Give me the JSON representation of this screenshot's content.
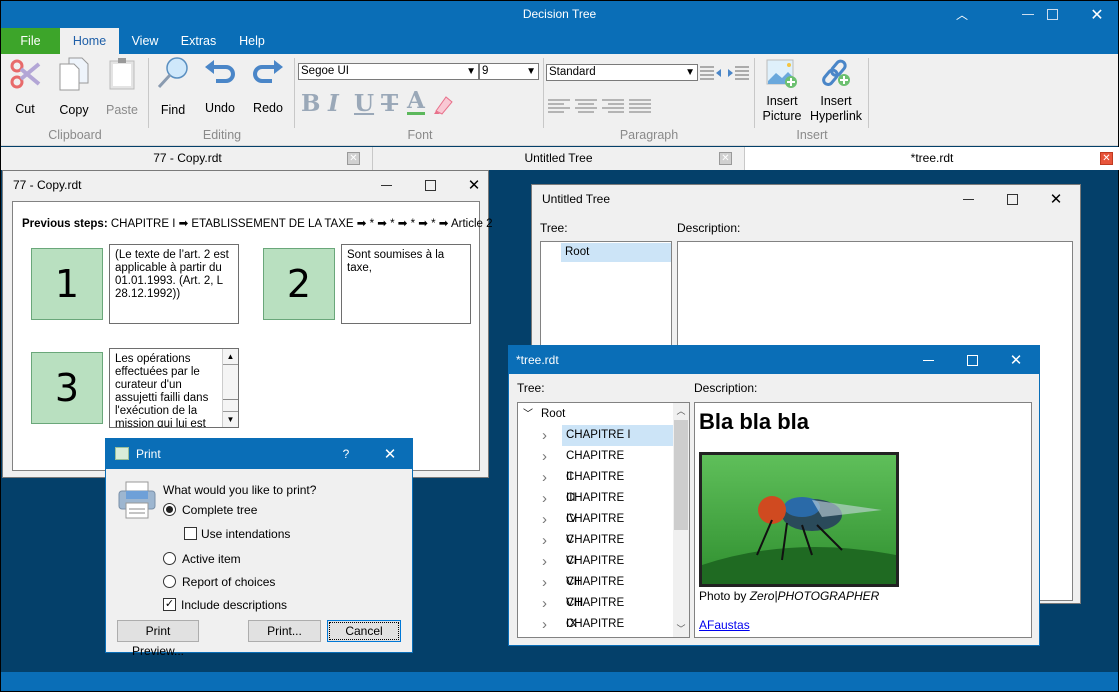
{
  "app": {
    "title": "Decision Tree"
  },
  "menu": {
    "tabs": [
      "File",
      "Home",
      "View",
      "Extras",
      "Help"
    ]
  },
  "ribbon": {
    "clipboard": {
      "label": "Clipboard",
      "cut": "Cut",
      "copy": "Copy",
      "paste": "Paste"
    },
    "editing": {
      "label": "Editing",
      "find": "Find",
      "undo": "Undo",
      "redo": "Redo"
    },
    "font": {
      "label": "Font",
      "family": "Segoe UI",
      "size": "9",
      "styles": [
        "B",
        "I",
        "U",
        "T",
        "A"
      ]
    },
    "paragraph": {
      "label": "Paragraph",
      "style": "Standard"
    },
    "insert": {
      "label": "Insert",
      "picture_l1": "Insert",
      "picture_l2": "Picture",
      "link_l1": "Insert",
      "link_l2": "Hyperlink"
    }
  },
  "doc_tabs": [
    {
      "label": "77 - Copy.rdt",
      "active": false
    },
    {
      "label": "Untitled Tree",
      "active": false
    },
    {
      "label": "*tree.rdt",
      "active": true
    }
  ],
  "win_copy": {
    "title": "77 - Copy.rdt",
    "prev_label": "Previous steps:",
    "prev_path": "CHAPITRE I ➡ ETABLISSEMENT DE LA TAXE ➡ * ➡ * ➡ * ➡ * ➡ Article 2",
    "choices": [
      {
        "num": "1",
        "text": "(Le texte de l’art. 2 est applicable à partir du 01.01.1993. (Art. 2, L 28.12.1992))"
      },
      {
        "num": "2",
        "text": "Sont soumises à la taxe,"
      },
      {
        "num": "3",
        "text": "Les opérations effectuées par le curateur d'un assujetti failli dans l'exécution de la mission qui lui est"
      }
    ]
  },
  "win_untitled": {
    "title": "Untitled Tree",
    "tree_label": "Tree:",
    "desc_label": "Description:",
    "root": "Root"
  },
  "win_tree": {
    "title": "*tree.rdt",
    "tree_label": "Tree:",
    "desc_label": "Description:",
    "root": "Root",
    "items": [
      "CHAPITRE I",
      "CHAPITRE II",
      "CHAPITRE III",
      "CHAPITRE IV",
      "CHAPITRE V",
      "CHAPITRE VI",
      "CHAPITRE VII",
      "CHAPITRE VIII",
      "CHAPITRE IX",
      "CHAPITRE X"
    ],
    "selected": "CHAPITRE I",
    "desc_heading": "Bla bla bla",
    "photo_caption_prefix": "Photo by ",
    "photo_caption_author": "Zero|PHOTOGRAPHER",
    "link": "AFaustas"
  },
  "print_dialog": {
    "title": "Print",
    "help": "?",
    "question": "What would you like to print?",
    "opt_complete": "Complete tree",
    "opt_indent": "Use intendations",
    "opt_active": "Active item",
    "opt_report": "Report of choices",
    "opt_desc": "Include descriptions",
    "btn_preview": "Print Preview...",
    "btn_print": "Print...",
    "btn_cancel": "Cancel"
  }
}
